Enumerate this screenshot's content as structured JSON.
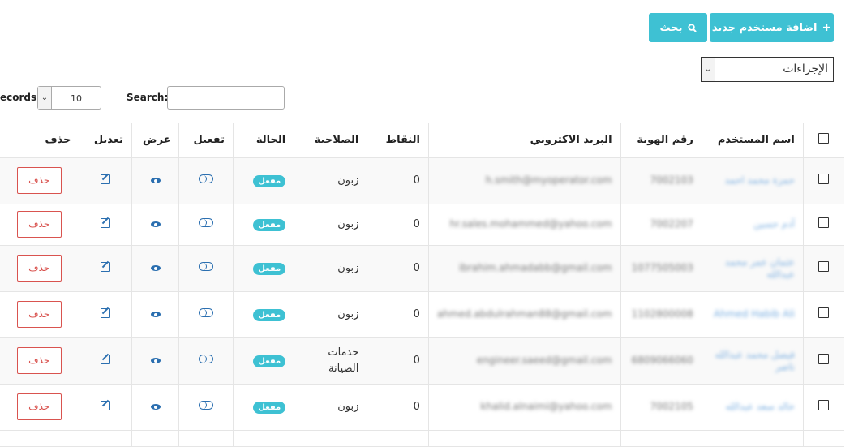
{
  "toolbar": {
    "add_user_label": "اضافة مستخدم جديد",
    "add_icon": "+",
    "search_label": "بحث",
    "search_icon": "search-icon",
    "actions_value": "الإجراءات"
  },
  "list_controls": {
    "records_label": "ecords",
    "page_length": "10",
    "search_label": "Search:",
    "search_value": ""
  },
  "table": {
    "headers": {
      "name": "اسم المستخدم",
      "id_number": "رقم الهوية",
      "email": "البريد الاكتروني",
      "points": "النقاط",
      "permission": "الصلاحية",
      "status": "الحالة",
      "activate": "تفعيل",
      "view": "عرض",
      "edit": "تعديل",
      "delete": "حذف"
    },
    "rows": [
      {
        "name": "حمزة محمد احمد",
        "id_number": "7002103",
        "email": "h.smith@myoperator.com",
        "points": "0",
        "permission": "زبون",
        "status": "مفعل",
        "delete": "حذف"
      },
      {
        "name": "آدم حسين",
        "id_number": "7002207",
        "email": "hr.sales.mohammed@yahoo.com",
        "points": "0",
        "permission": "زبون",
        "status": "مفعل",
        "delete": "حذف"
      },
      {
        "name": "عثمان عمر محمد عبدالله",
        "id_number": "1077505003",
        "email": "ibrahim.ahmadabb@gmail.com",
        "points": "0",
        "permission": "زبون",
        "status": "مفعل",
        "delete": "حذف"
      },
      {
        "name": "Ahmed Habib Ali",
        "id_number": "1102800008",
        "email": "ahmed.abdulrahman88@gmail.com",
        "points": "0",
        "permission": "زبون",
        "status": "مفعل",
        "delete": "حذف"
      },
      {
        "name": "فيصل محمد عبدالله ناصر",
        "id_number": "6809066060",
        "email": "engineer.saeed@gmail.com",
        "points": "0",
        "permission": "خدمات الصيانة",
        "status": "مفعل",
        "delete": "حذف"
      },
      {
        "name": "خالد سعد عبدالله",
        "id_number": "7002105",
        "email": "khalid.alnaimi@yahoo.com",
        "points": "0",
        "permission": "زبون",
        "status": "مفعل",
        "delete": "حذف"
      }
    ]
  }
}
